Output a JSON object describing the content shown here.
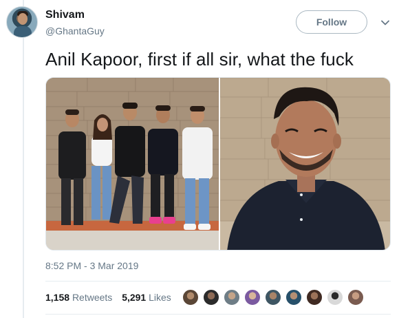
{
  "user": {
    "name": "Shivam",
    "handle": "@GhantaGuy"
  },
  "follow_label": "Follow",
  "tweet_text": "Anil Kapoor, first if all sir, what the fuck",
  "timestamp": "8:52 PM - 3 Mar 2019",
  "stats": {
    "retweets_count": "1,158",
    "retweets_label": "Retweets",
    "likes_count": "5,291",
    "likes_label": "Likes"
  },
  "liker_avatar_count": 9,
  "colors": {
    "text_primary": "#14171a",
    "text_secondary": "#657786",
    "border": "#e6ecf0",
    "follow_border": "#aab8c2"
  },
  "icons": {
    "caret": "chevron-down-icon"
  }
}
